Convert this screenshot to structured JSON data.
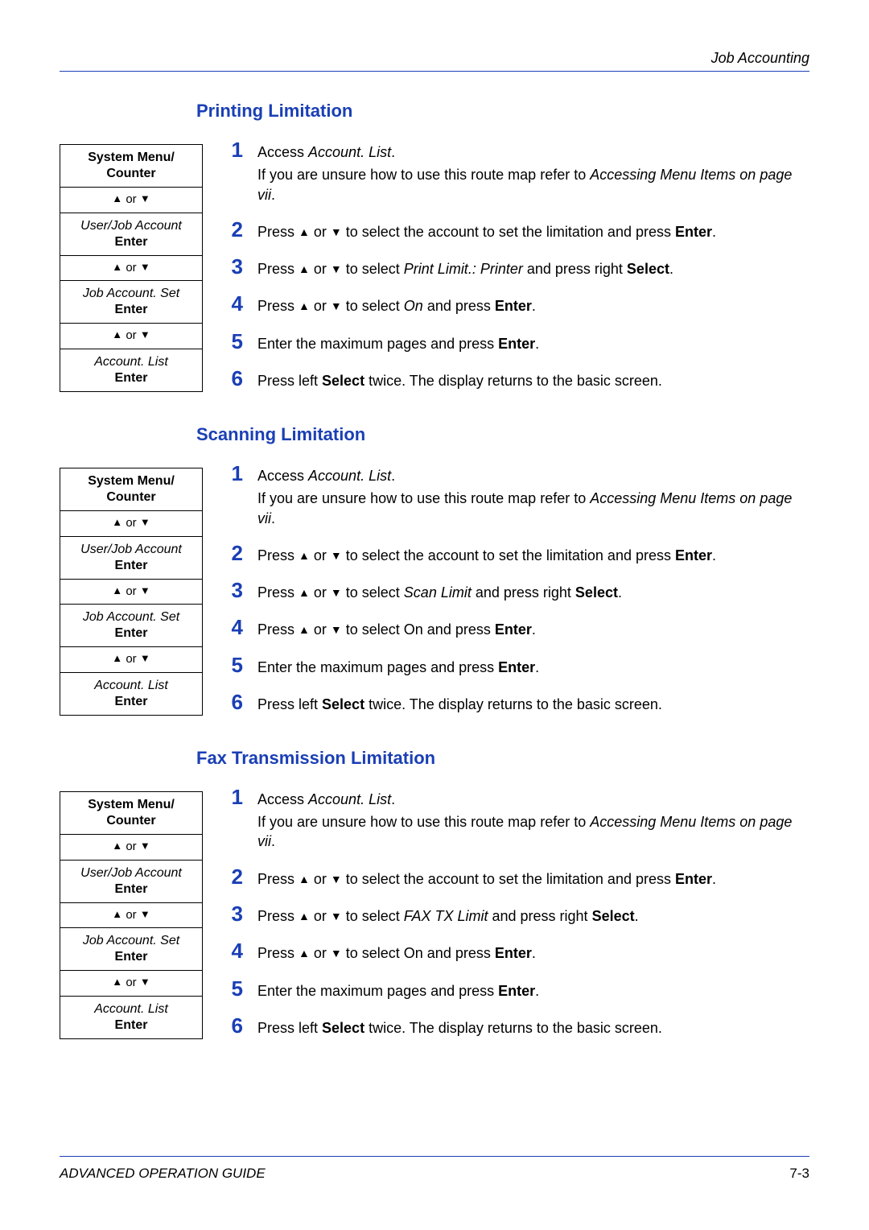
{
  "header": {
    "title": "Job Accounting"
  },
  "glyphs": {
    "up": "▲",
    "down": "▼",
    "or": " or "
  },
  "routemap": {
    "cells": [
      {
        "primary": "System Menu/ Counter"
      },
      {
        "nav": true
      },
      {
        "secondary": "User/Job Account",
        "primary": "Enter"
      },
      {
        "nav": true
      },
      {
        "secondary": "Job Account. Set",
        "primary": "Enter"
      },
      {
        "nav": true
      },
      {
        "secondary": "Account. List",
        "primary": "Enter"
      }
    ]
  },
  "sections": [
    {
      "heading": "Printing Limitation",
      "steps": [
        {
          "n": "1",
          "parts": [
            [
              {
                "t": "Access "
              },
              {
                "t": "Account. List",
                "i": true
              },
              {
                "t": "."
              }
            ],
            [
              {
                "t": "If you are unsure how to use this route map refer to "
              },
              {
                "t": "Accessing Menu Items on page vii",
                "i": true
              },
              {
                "t": "."
              }
            ]
          ]
        },
        {
          "n": "2",
          "parts": [
            [
              {
                "t": "Press "
              },
              {
                "t": "▲",
                "tri": true
              },
              {
                "t": " or "
              },
              {
                "t": "▼",
                "tri": true
              },
              {
                "t": " to select the account to set the limitation and press "
              },
              {
                "t": "Enter",
                "b": true
              },
              {
                "t": "."
              }
            ]
          ]
        },
        {
          "n": "3",
          "parts": [
            [
              {
                "t": "Press "
              },
              {
                "t": "▲",
                "tri": true
              },
              {
                "t": " or "
              },
              {
                "t": "▼",
                "tri": true
              },
              {
                "t": " to select "
              },
              {
                "t": "Print Limit.: Printer",
                "i": true
              },
              {
                "t": " and press right "
              },
              {
                "t": "Select",
                "b": true
              },
              {
                "t": "."
              }
            ]
          ]
        },
        {
          "n": "4",
          "parts": [
            [
              {
                "t": "Press "
              },
              {
                "t": "▲",
                "tri": true
              },
              {
                "t": " or "
              },
              {
                "t": "▼",
                "tri": true
              },
              {
                "t": " to select "
              },
              {
                "t": "On",
                "i": true
              },
              {
                "t": " and press "
              },
              {
                "t": "Enter",
                "b": true
              },
              {
                "t": "."
              }
            ]
          ]
        },
        {
          "n": "5",
          "parts": [
            [
              {
                "t": "Enter the maximum pages and press "
              },
              {
                "t": "Enter",
                "b": true
              },
              {
                "t": "."
              }
            ]
          ]
        },
        {
          "n": "6",
          "parts": [
            [
              {
                "t": "Press left "
              },
              {
                "t": "Select",
                "b": true
              },
              {
                "t": " twice. The display returns to the basic screen."
              }
            ]
          ]
        }
      ]
    },
    {
      "heading": "Scanning Limitation",
      "steps": [
        {
          "n": "1",
          "parts": [
            [
              {
                "t": "Access "
              },
              {
                "t": "Account. List",
                "i": true
              },
              {
                "t": "."
              }
            ],
            [
              {
                "t": "If you are unsure how to use this route map refer to "
              },
              {
                "t": "Accessing Menu Items on page vii",
                "i": true
              },
              {
                "t": "."
              }
            ]
          ]
        },
        {
          "n": "2",
          "parts": [
            [
              {
                "t": "Press "
              },
              {
                "t": "▲",
                "tri": true
              },
              {
                "t": " or "
              },
              {
                "t": "▼",
                "tri": true
              },
              {
                "t": " to select the account to set the limitation and press "
              },
              {
                "t": "Enter",
                "b": true
              },
              {
                "t": "."
              }
            ]
          ]
        },
        {
          "n": "3",
          "parts": [
            [
              {
                "t": "Press "
              },
              {
                "t": "▲",
                "tri": true
              },
              {
                "t": " or "
              },
              {
                "t": "▼",
                "tri": true
              },
              {
                "t": " to select "
              },
              {
                "t": "Scan Limit",
                "i": true
              },
              {
                "t": " and press right "
              },
              {
                "t": "Select",
                "b": true
              },
              {
                "t": "."
              }
            ]
          ]
        },
        {
          "n": "4",
          "parts": [
            [
              {
                "t": "Press "
              },
              {
                "t": "▲",
                "tri": true
              },
              {
                "t": " or "
              },
              {
                "t": "▼",
                "tri": true
              },
              {
                "t": " to select On and press "
              },
              {
                "t": "Enter",
                "b": true
              },
              {
                "t": "."
              }
            ]
          ]
        },
        {
          "n": "5",
          "parts": [
            [
              {
                "t": "Enter the maximum pages and press "
              },
              {
                "t": "Enter",
                "b": true
              },
              {
                "t": "."
              }
            ]
          ]
        },
        {
          "n": "6",
          "parts": [
            [
              {
                "t": "Press left "
              },
              {
                "t": "Select",
                "b": true
              },
              {
                "t": " twice. The display returns to the basic screen."
              }
            ]
          ]
        }
      ]
    },
    {
      "heading": "Fax Transmission Limitation",
      "steps": [
        {
          "n": "1",
          "parts": [
            [
              {
                "t": "Access "
              },
              {
                "t": "Account. List",
                "i": true
              },
              {
                "t": "."
              }
            ],
            [
              {
                "t": "If you are unsure how to use this route map refer to "
              },
              {
                "t": "Accessing Menu Items on page vii",
                "i": true
              },
              {
                "t": "."
              }
            ]
          ]
        },
        {
          "n": "2",
          "parts": [
            [
              {
                "t": "Press "
              },
              {
                "t": "▲",
                "tri": true
              },
              {
                "t": " or "
              },
              {
                "t": "▼",
                "tri": true
              },
              {
                "t": " to select the account to set the limitation and press "
              },
              {
                "t": "Enter",
                "b": true
              },
              {
                "t": "."
              }
            ]
          ]
        },
        {
          "n": "3",
          "parts": [
            [
              {
                "t": "Press "
              },
              {
                "t": "▲",
                "tri": true
              },
              {
                "t": " or "
              },
              {
                "t": "▼",
                "tri": true
              },
              {
                "t": " to select "
              },
              {
                "t": "FAX TX Limit",
                "i": true
              },
              {
                "t": " and press right "
              },
              {
                "t": "Select",
                "b": true
              },
              {
                "t": "."
              }
            ]
          ]
        },
        {
          "n": "4",
          "parts": [
            [
              {
                "t": "Press "
              },
              {
                "t": "▲",
                "tri": true
              },
              {
                "t": " or "
              },
              {
                "t": "▼",
                "tri": true
              },
              {
                "t": " to select On and press "
              },
              {
                "t": "Enter",
                "b": true
              },
              {
                "t": "."
              }
            ]
          ]
        },
        {
          "n": "5",
          "parts": [
            [
              {
                "t": "Enter the maximum pages and press "
              },
              {
                "t": "Enter",
                "b": true
              },
              {
                "t": "."
              }
            ]
          ]
        },
        {
          "n": "6",
          "parts": [
            [
              {
                "t": "Press left "
              },
              {
                "t": "Select",
                "b": true
              },
              {
                "t": " twice. The display returns to the basic screen."
              }
            ]
          ]
        }
      ]
    }
  ],
  "footer": {
    "left": "ADVANCED OPERATION GUIDE",
    "right": "7-3"
  }
}
